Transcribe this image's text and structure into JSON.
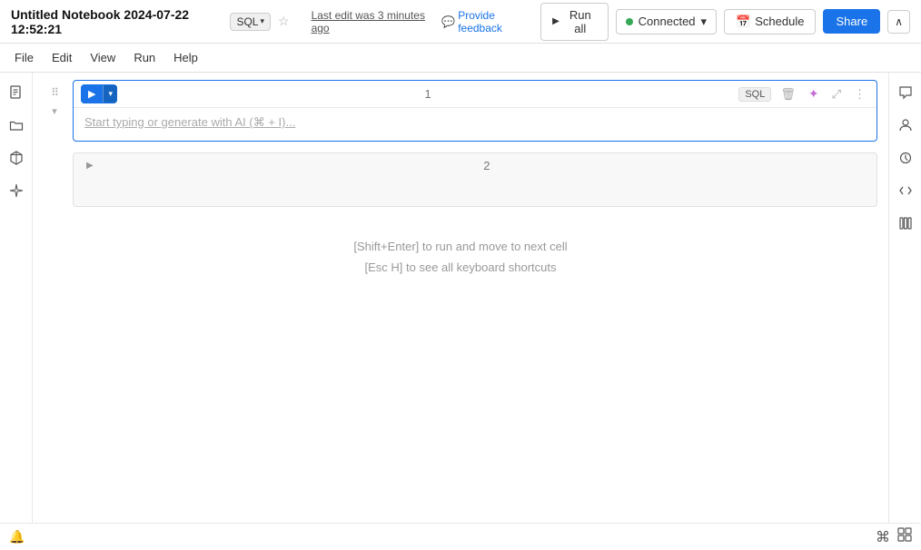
{
  "header": {
    "title": "Untitled Notebook 2024-07-22 12:52:21",
    "sql_badge": "SQL",
    "last_edit": "Last edit was 3 minutes ago",
    "provide_feedback": "Provide feedback",
    "run_all": "Run all",
    "connected": "Connected",
    "schedule": "Schedule",
    "share": "Share"
  },
  "menu": {
    "items": [
      "File",
      "Edit",
      "View",
      "Run",
      "Help"
    ]
  },
  "cells": [
    {
      "number": "1",
      "type": "SQL",
      "placeholder_main": "Start typing or ",
      "placeholder_link": "generate",
      "placeholder_end": " with AI (⌘ + I)...",
      "active": true
    },
    {
      "number": "2",
      "active": false
    }
  ],
  "hints": {
    "line1": "[Shift+Enter] to run and move to next cell",
    "line2": "[Esc H] to see all keyboard shortcuts"
  },
  "sidebar": {
    "left_icons": [
      "document",
      "folder",
      "package",
      "sparkle"
    ],
    "right_icons": [
      "chat",
      "person",
      "history",
      "code",
      "library"
    ]
  },
  "bottom": {
    "cmd_icon": "⌘",
    "grid_icon": "⊞"
  }
}
